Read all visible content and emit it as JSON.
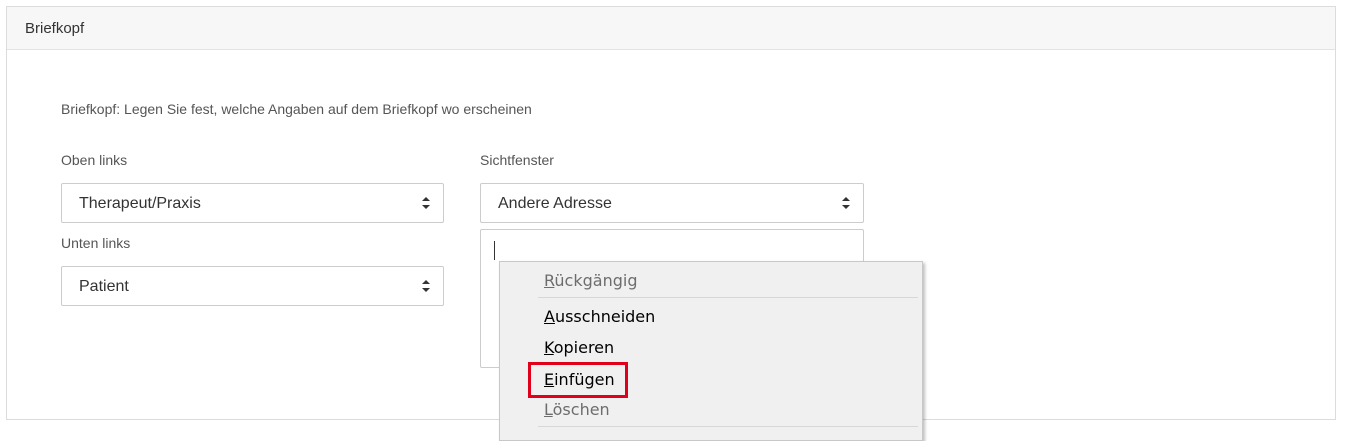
{
  "panel": {
    "title": "Briefkopf",
    "intro": "Briefkopf: Legen Sie fest, welche Angaben auf dem Briefkopf wo erscheinen"
  },
  "fields": {
    "top_left": {
      "label": "Oben links",
      "value": "Therapeut/Praxis"
    },
    "bottom_left": {
      "label": "Unten links",
      "value": "Patient"
    },
    "window": {
      "label": "Sichtfenster",
      "value": "Andere Adresse",
      "text": ""
    }
  },
  "context_menu": {
    "items": [
      {
        "accel": "R",
        "rest": "ückgängig",
        "enabled": false
      },
      {
        "accel": "A",
        "rest": "usschneiden",
        "enabled": true
      },
      {
        "accel": "K",
        "rest": "opieren",
        "enabled": true
      },
      {
        "accel": "E",
        "rest": "infügen",
        "enabled": true,
        "highlighted": true
      },
      {
        "accel": "L",
        "rest": "öschen",
        "enabled": false
      }
    ]
  },
  "colors": {
    "highlight": "#e0001b",
    "border": "#cccccc",
    "header_bg": "#f7f7f7",
    "menu_bg": "#f0f0f0"
  },
  "icons": {
    "select_caret": "up-down-caret-icon"
  }
}
